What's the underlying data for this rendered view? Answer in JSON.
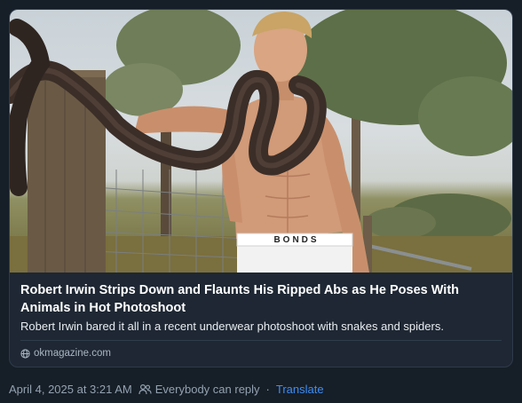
{
  "article": {
    "headline": "Robert Irwin Strips Down and Flaunts His Ripped Abs as He Poses With Animals in Hot Photoshoot",
    "description": "Robert Irwin bared it all in a recent underwear photoshoot with snakes and spiders.",
    "domain": "okmagazine.com",
    "image_text": "BONDS"
  },
  "post_meta": {
    "timestamp": "April 4, 2025 at 3:21 AM",
    "reply_setting": "Everybody can reply",
    "separator": "·",
    "translate_label": "Translate"
  },
  "icons": {
    "link": "globe-icon",
    "reply": "people-icon"
  },
  "colors": {
    "background": "#161e27",
    "card_border": "#2e3b4a",
    "link_accent": "#3d8df5",
    "muted_text": "#93a2b1"
  }
}
